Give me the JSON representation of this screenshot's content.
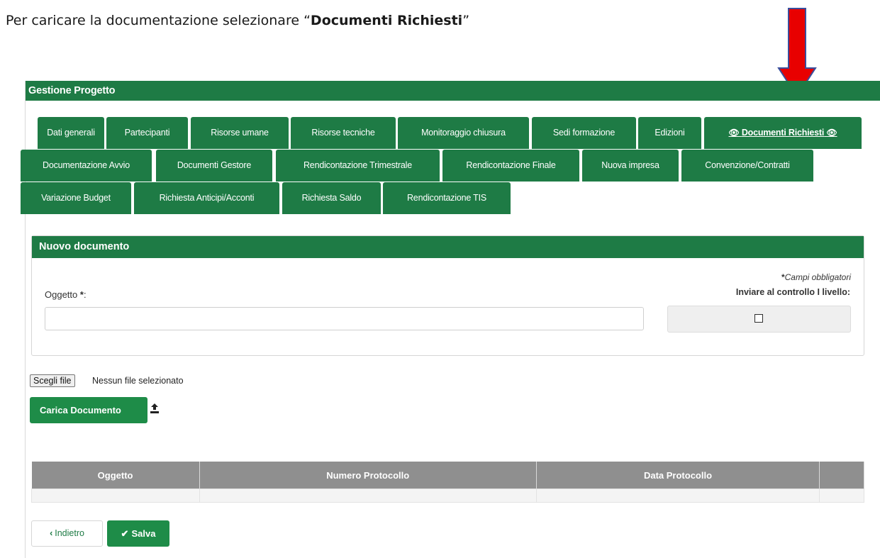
{
  "instruction": {
    "prefix": "Per caricare la documentazione selezionare “",
    "highlight": "Documenti Richiesti",
    "suffix": "”"
  },
  "colors": {
    "primary_green": "#1e7b45",
    "button_green": "#1e8c48",
    "arrow_red": "#e80000",
    "arrow_outline": "#3a4e9c",
    "table_header": "#8f8f8f"
  },
  "panel": {
    "title": "Gestione Progetto"
  },
  "tabs": {
    "row1": [
      {
        "label": "Dati generali"
      },
      {
        "label": "Partecipanti"
      },
      {
        "label": "Risorse umane"
      },
      {
        "label": "Risorse tecniche"
      },
      {
        "label": "Monitoraggio chiusura"
      },
      {
        "label": "Sedi formazione"
      },
      {
        "label": "Edizioni"
      },
      {
        "label": "Documenti Richiesti",
        "active": true,
        "icon": "eye-icon"
      }
    ],
    "row2": [
      {
        "label": "Documentazione Avvio"
      },
      {
        "label": "Documenti Gestore"
      },
      {
        "label": "Rendicontazione Trimestrale"
      },
      {
        "label": "Rendicontazione Finale"
      },
      {
        "label": "Nuova impresa"
      },
      {
        "label": "Convenzione/Contratti"
      }
    ],
    "row3": [
      {
        "label": "Variazione Budget"
      },
      {
        "label": "Richiesta Anticipi/Acconti"
      },
      {
        "label": "Richiesta Saldo"
      },
      {
        "label": "Rendicontazione TIS"
      }
    ]
  },
  "new_document": {
    "title": "Nuovo documento",
    "required_note": "Campi obbligatori",
    "required_star": "*",
    "field_label": "Oggetto ",
    "field_label_suffix": ":",
    "field_value": "",
    "checkbox_label": "Inviare al controllo I livello:",
    "checkbox_checked": false
  },
  "file": {
    "button_label": "Scegli file",
    "status": "Nessun file selezionato"
  },
  "upload": {
    "button_label": "Carica Documento",
    "icon": "upload-icon"
  },
  "table": {
    "columns": [
      "Oggetto",
      "Numero Protocollo",
      "Data Protocollo",
      ""
    ],
    "rows": [
      [
        "",
        "",
        "",
        ""
      ]
    ]
  },
  "actions": {
    "back_label": "Indietro",
    "back_icon": "chevron-left-icon",
    "save_label": "Salva",
    "save_icon": "check-icon"
  }
}
